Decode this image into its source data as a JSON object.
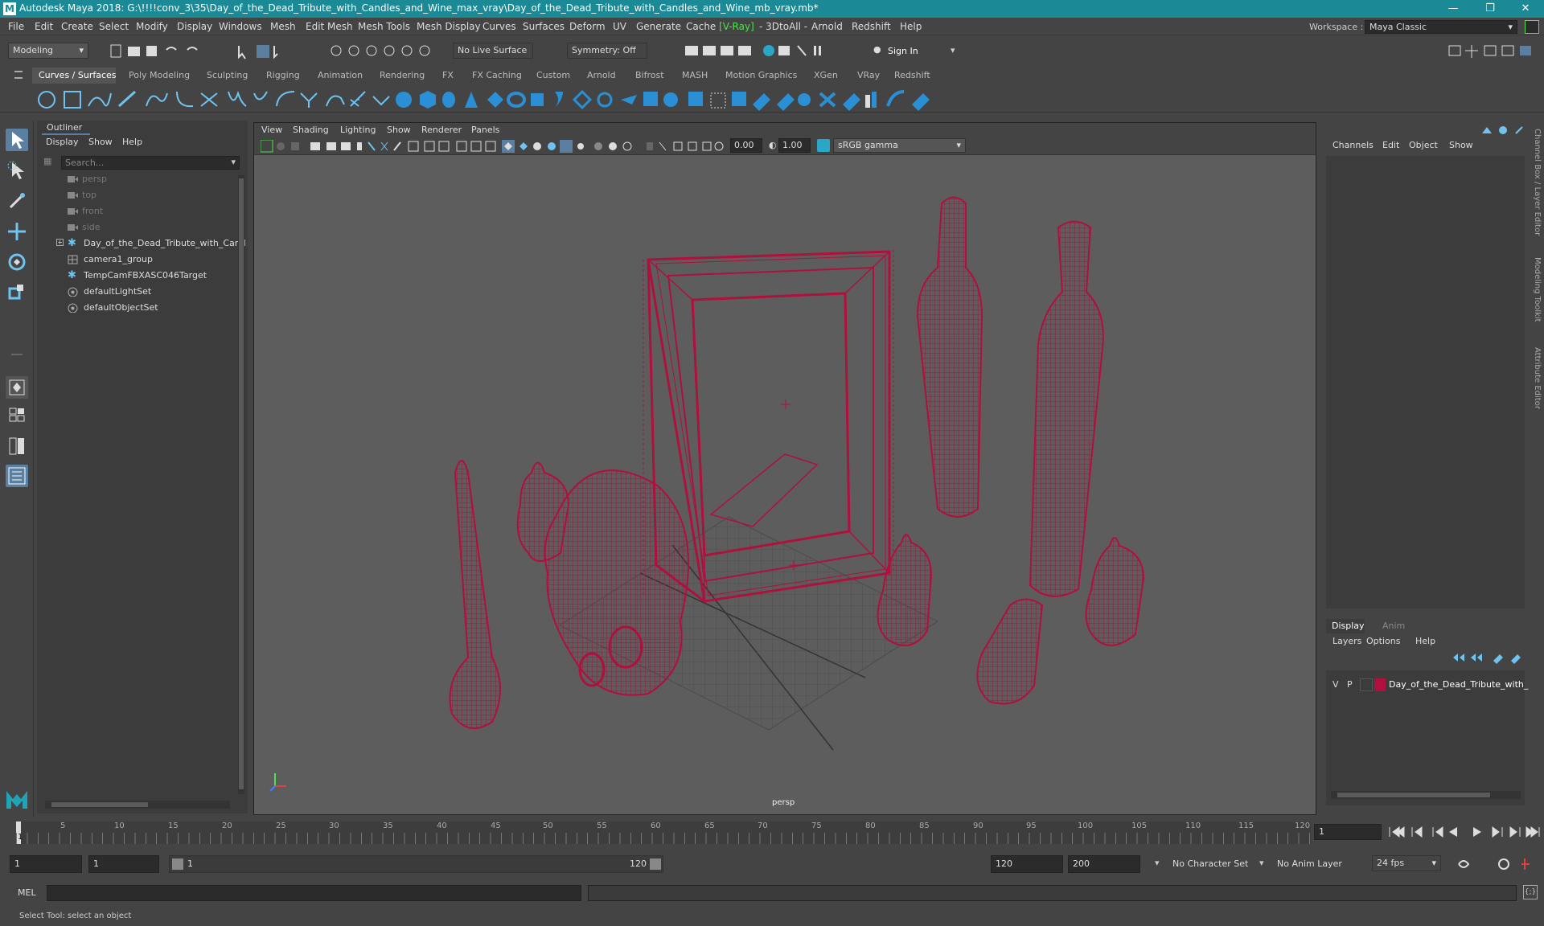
{
  "window": {
    "title": "Autodesk Maya 2018: G:\\!!!!conv_3\\35\\Day_of_the_Dead_Tribute_with_Candles_and_Wine_max_vray\\Day_of_the_Dead_Tribute_with_Candles_and_Wine_mb_vray.mb*",
    "logo": "M"
  },
  "menu": [
    "File",
    "Edit",
    "Create",
    "Select",
    "Modify",
    "Display",
    "Windows",
    "Mesh",
    "Edit Mesh",
    "Mesh Tools",
    "Mesh Display",
    "Curves",
    "Surfaces",
    "Deform",
    "UV",
    "Generate",
    "Cache",
    "V-Ray",
    "- 3DtoAll -",
    "Arnold",
    "Redshift",
    "Help"
  ],
  "workspace": {
    "label": "Workspace :",
    "value": "Maya Classic"
  },
  "status": {
    "mode": "Modeling",
    "live_surface": "No Live Surface",
    "symmetry": "Symmetry: Off",
    "sign_in": "Sign In"
  },
  "shelf_tabs": [
    "Curves / Surfaces",
    "Poly Modeling",
    "Sculpting",
    "Rigging",
    "Animation",
    "Rendering",
    "FX",
    "FX Caching",
    "Custom",
    "Arnold",
    "Bifrost",
    "MASH",
    "Motion Graphics",
    "XGen",
    "VRay",
    "Redshift"
  ],
  "outliner": {
    "title": "Outliner",
    "menus": [
      "Display",
      "Show",
      "Help"
    ],
    "search_placeholder": "Search...",
    "items": [
      {
        "label": "persp",
        "icon": "camera-icon"
      },
      {
        "label": "top",
        "icon": "camera-icon"
      },
      {
        "label": "front",
        "icon": "camera-icon"
      },
      {
        "label": "side",
        "icon": "camera-icon"
      },
      {
        "label": "Day_of_the_Dead_Tribute_with_Cand",
        "icon": "group-icon"
      },
      {
        "label": "camera1_group",
        "icon": "group-icon"
      },
      {
        "label": "TempCamFBXASC046Target",
        "icon": "locator-icon"
      },
      {
        "label": "defaultLightSet",
        "icon": "set-icon"
      },
      {
        "label": "defaultObjectSet",
        "icon": "set-icon"
      }
    ]
  },
  "viewport": {
    "menus": [
      "View",
      "Shading",
      "Lighting",
      "Show",
      "Renderer",
      "Panels"
    ],
    "exposure": "0.00",
    "gamma": "1.00",
    "color_space": "sRGB gamma",
    "camera_label": "persp",
    "wire_color": "#b0103e"
  },
  "channel_box": {
    "menus": [
      "Channels",
      "Edit",
      "Object",
      "Show"
    ]
  },
  "side_tabs": [
    "Channel Box / Layer Editor",
    "Modeling Toolkit",
    "Attribute Editor"
  ],
  "layer_editor": {
    "tabs": [
      "Display",
      "Anim"
    ],
    "menus": [
      "Layers",
      "Options",
      "Help"
    ],
    "layer": {
      "v": "V",
      "p": "P",
      "name": "Day_of_the_Dead_Tribute_with_",
      "color": "#b0103e"
    }
  },
  "timeline": {
    "ticks": [
      "5",
      "10",
      "15",
      "20",
      "25",
      "30",
      "35",
      "40",
      "45",
      "50",
      "55",
      "60",
      "65",
      "70",
      "75",
      "80",
      "85",
      "90",
      "95",
      "100",
      "105",
      "110",
      "115",
      "120"
    ],
    "current_marker": "1",
    "current_frame": "1"
  },
  "range": {
    "start": "1",
    "anim_start": "1",
    "slider_start": "1",
    "slider_end": "120",
    "end": "120",
    "anim_end": "200",
    "character_set": "No Character Set",
    "anim_layer": "No Anim Layer",
    "fps": "24 fps"
  },
  "command": {
    "lang": "MEL"
  },
  "help_line": "Select Tool: select an object"
}
